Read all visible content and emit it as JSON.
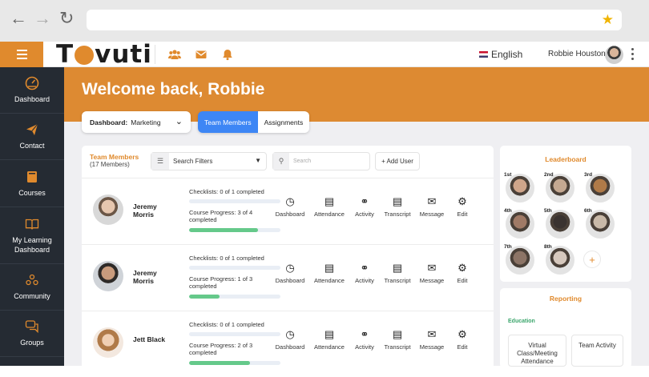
{
  "browser": {
    "back_icon": "arrow-left-icon",
    "forward_icon": "arrow-right-icon",
    "reload_icon": "reload-icon",
    "bookmark_icon": "star-icon"
  },
  "header": {
    "logo_text_pre": "T",
    "logo_text_post": "vuti",
    "icons": [
      "users-icon",
      "mail-icon",
      "bell-icon"
    ],
    "language": "English",
    "user_name": "Robbie Houston"
  },
  "sidebar": {
    "items": [
      {
        "label": "Dashboard",
        "icon": "dashboard-gauge-icon"
      },
      {
        "label": "Contact",
        "icon": "paper-plane-icon"
      },
      {
        "label": "Courses",
        "icon": "book-icon"
      },
      {
        "label": "My Learning Dashboard",
        "icon": "open-book-icon"
      },
      {
        "label": "Community",
        "icon": "community-icon"
      },
      {
        "label": "Groups",
        "icon": "chat-bubbles-icon"
      }
    ]
  },
  "banner": {
    "welcome": "Welcome back, Robbie"
  },
  "dashboard_select": {
    "label": "Dashboard:",
    "value": "Marketing"
  },
  "tabs": [
    {
      "label": "Team Members",
      "active": true
    },
    {
      "label": "Assignments",
      "active": false
    }
  ],
  "team": {
    "title": "Team Members",
    "count": "(17 Members)",
    "filter_label": "Search Filters",
    "search_placeholder": "Search",
    "add_user": "+ Add User",
    "actions": [
      {
        "label": "Dashboard",
        "icon": "gauge-icon"
      },
      {
        "label": "Attendance",
        "icon": "attendance-icon"
      },
      {
        "label": "Activity",
        "icon": "activity-icon"
      },
      {
        "label": "Transcript",
        "icon": "clipboard-icon"
      },
      {
        "label": "Message",
        "icon": "envelope-icon"
      },
      {
        "label": "Edit",
        "icon": "gear-icon"
      }
    ],
    "members": [
      {
        "name": "Jeremy Morris",
        "checklists": "Checklists: 0 of 1 completed",
        "checklist_progress": 0,
        "course_progress_text": "Course Progress: 3 of 4 completed",
        "course_progress": 0.75
      },
      {
        "name": "Jeremy Morris",
        "checklists": "Checklists: 0 of 1 completed",
        "checklist_progress": 0,
        "course_progress_text": "Course Progress: 1 of 3 completed",
        "course_progress": 0.33
      },
      {
        "name": "Jett Black",
        "checklists": "Checklists: 0 of 1 completed",
        "checklist_progress": 0,
        "course_progress_text": "Course Progress: 2 of 3 completed",
        "course_progress": 0.67
      }
    ]
  },
  "leaderboard": {
    "title": "Leaderboard",
    "ranks": [
      "1st",
      "2nd",
      "3rd",
      "4th",
      "5th",
      "6th",
      "7th",
      "8th"
    ],
    "add_icon": "plus-icon"
  },
  "reporting": {
    "title": "Reporting",
    "section": "Education",
    "cards": [
      "Virtual Class/Meeting Attendance",
      "Team Activity"
    ]
  }
}
